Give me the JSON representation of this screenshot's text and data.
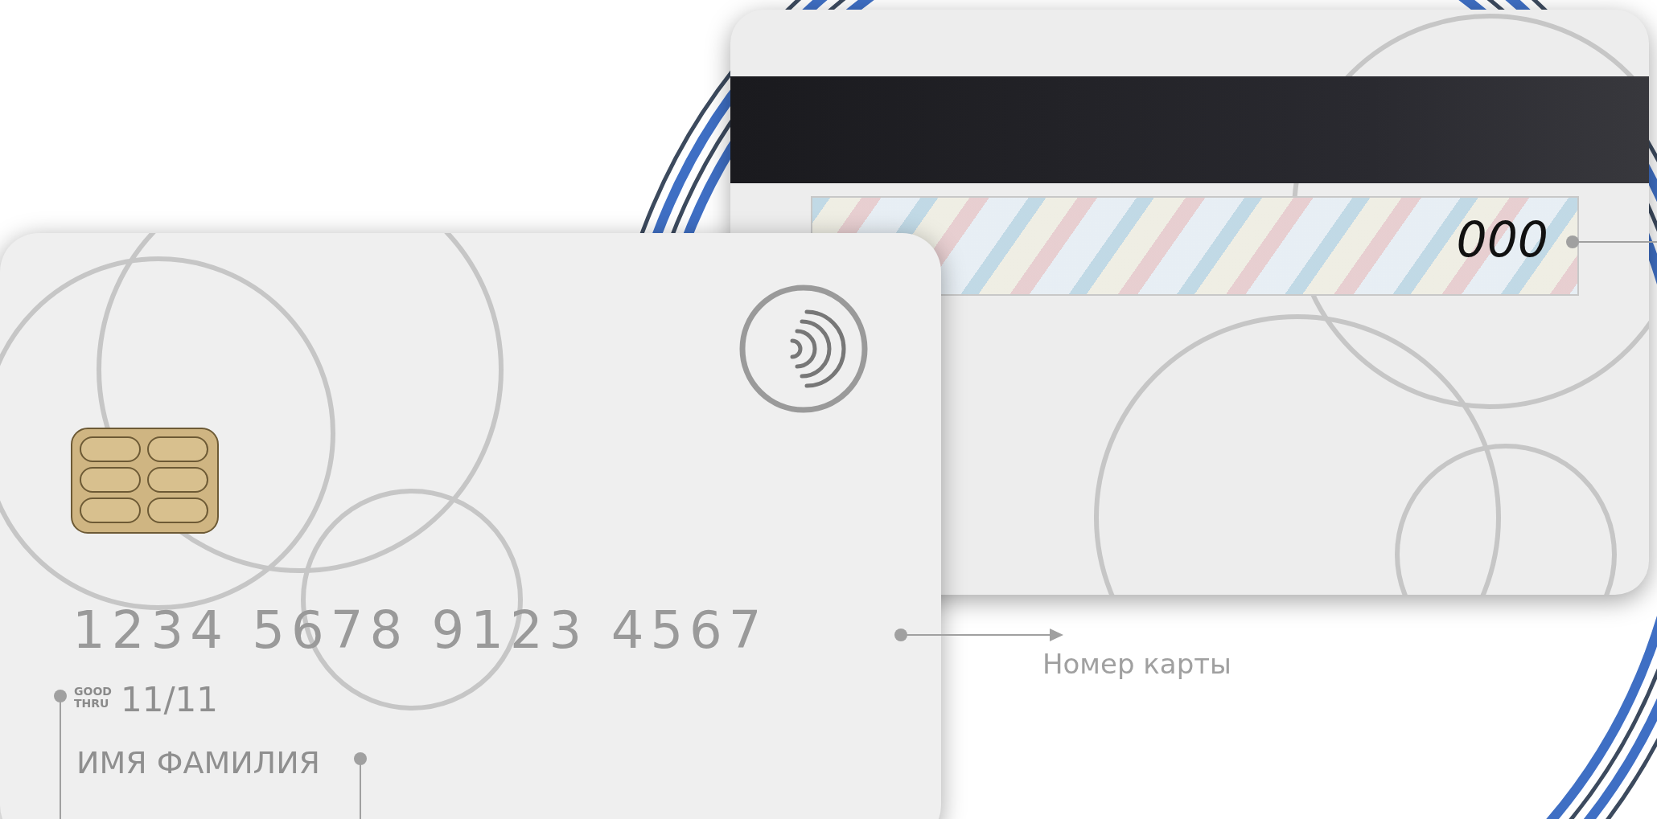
{
  "back_card": {
    "cvv": "000"
  },
  "front_card": {
    "card_number": "1234 5678 9123 4567",
    "expiry_caption": "GOOD THRU",
    "expiry": "11/11",
    "holder_name": "ИМЯ ФАМИЛИЯ"
  },
  "callouts": [
    {
      "label": "Номер карты"
    }
  ]
}
